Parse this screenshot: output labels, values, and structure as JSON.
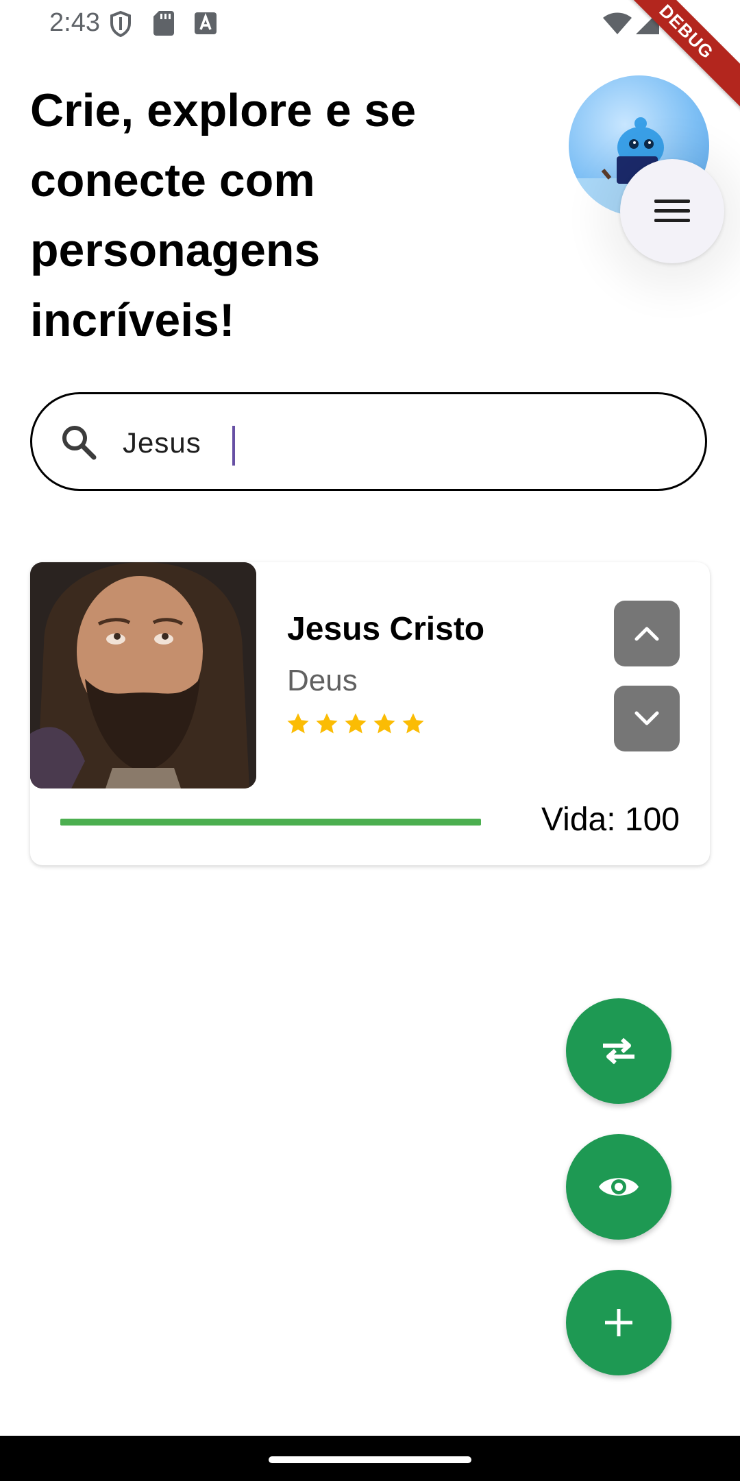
{
  "status_bar": {
    "time": "2:43",
    "icons": [
      "shield-icon",
      "sd-card-icon",
      "keyboard-a-icon",
      "wifi-icon",
      "signal-icon",
      "battery-icon"
    ],
    "debug_banner": "DEBUG"
  },
  "header": {
    "title": "Crie, explore e se conecte com personagens incríveis!"
  },
  "search": {
    "value": "Jesus",
    "icon": "search-icon"
  },
  "character": {
    "name": "Jesus Cristo",
    "role": "Deus",
    "rating": 5,
    "rating_max": 5,
    "life_label": "Vida: 100",
    "life_value": 100,
    "life_max": 100
  },
  "fabs": [
    {
      "icon": "swap-icon"
    },
    {
      "icon": "eye-icon"
    },
    {
      "icon": "plus-icon"
    }
  ],
  "colors": {
    "accent_green": "#1e9953",
    "life_bar": "#4caf50",
    "star": "#fbbc04",
    "arrow_button": "#767676",
    "caret": "#6750a4",
    "debug_banner": "#b3261e"
  }
}
